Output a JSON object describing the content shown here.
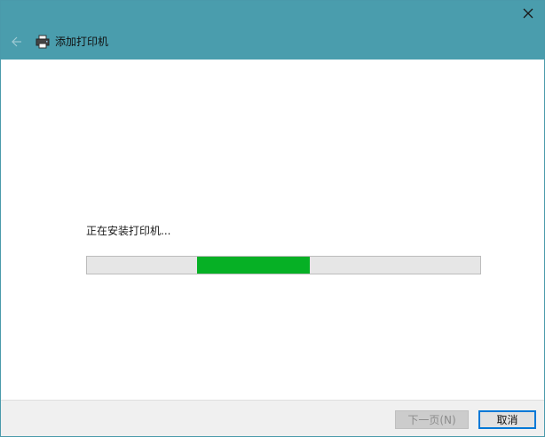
{
  "window": {
    "title": "添加打印机",
    "close_icon": "close-icon",
    "back_icon": "back-arrow-icon",
    "title_icon": "printer-icon",
    "accent_color": "#4a9dad"
  },
  "main": {
    "status_text": "正在安装打印机...",
    "progress": {
      "indeterminate": true,
      "fill_color": "#06b025"
    }
  },
  "footer": {
    "next_label": "下一页(N)",
    "next_enabled": false,
    "cancel_label": "取消"
  }
}
